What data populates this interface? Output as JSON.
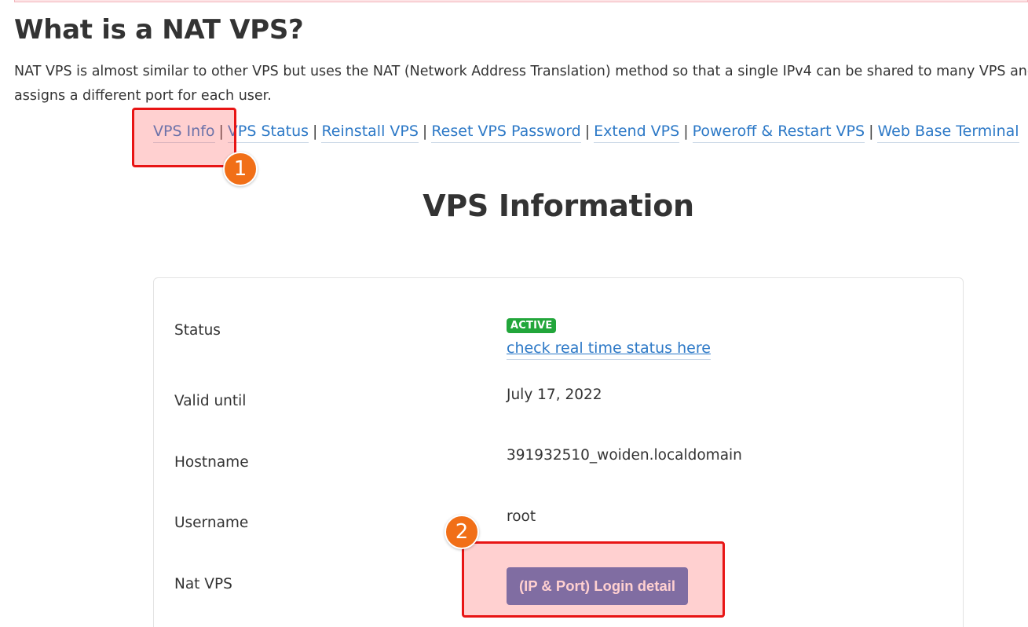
{
  "heading": "What is a NAT VPS?",
  "intro": {
    "line1": "NAT VPS is almost similar to other VPS but uses the NAT (Network Address Translation) method so that a single IPv4 can be shared to many VPS and",
    "line2": "assigns a different port for each user."
  },
  "nav": {
    "items": [
      {
        "label": "VPS Info"
      },
      {
        "label": "VPS Status"
      },
      {
        "label": "Reinstall VPS"
      },
      {
        "label": "Reset VPS Password"
      },
      {
        "label": "Extend VPS"
      },
      {
        "label": "Poweroff & Restart VPS"
      },
      {
        "label": "Web Base Terminal"
      }
    ],
    "separator": "|"
  },
  "title": "VPS Information",
  "info": {
    "status_label": "Status",
    "status_badge": "ACTIVE",
    "status_link": "check real time status here",
    "valid_label": "Valid until",
    "valid_value": "July 17, 2022",
    "hostname_label": "Hostname",
    "hostname_value": "391932510_woiden.localdomain",
    "username_label": "Username",
    "username_value": "root",
    "natvps_label": "Nat VPS",
    "login_button": "(IP & Port) Login detail"
  },
  "annotations": {
    "step1": "1",
    "step2": "2"
  },
  "colors": {
    "link": "#2d79c7",
    "badge": "#22a63b",
    "button": "#4a72bd",
    "highlight": "#e81515",
    "step_marker": "#f16f17"
  }
}
